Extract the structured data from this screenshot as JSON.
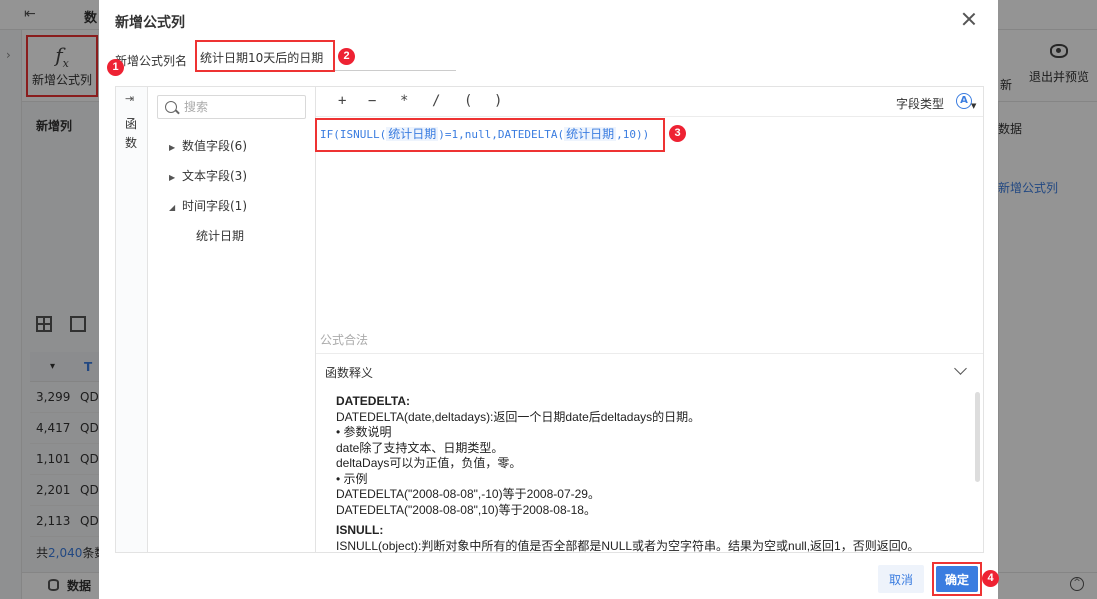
{
  "background": {
    "top_word": "数",
    "toolbar": {
      "add_formula_col": "新增公式列",
      "fx_symbol": "f",
      "fx_sub": "x",
      "right_word": "新",
      "exit_preview": "退出并预览"
    },
    "left_panel": {
      "new_col": "新增列"
    },
    "right_panel": {
      "data_word": "数据",
      "new_formula_col": "新增公式列"
    },
    "table": {
      "header_caret": "▾",
      "header_type": "T",
      "rows": [
        {
          "num": "3,299",
          "code": "QD"
        },
        {
          "num": "4,417",
          "code": "QD"
        },
        {
          "num": "1,101",
          "code": "QD"
        },
        {
          "num": "2,201",
          "code": "QD"
        },
        {
          "num": "2,113",
          "code": "QD"
        }
      ]
    },
    "total": {
      "prefix": "共",
      "count": "2,040",
      "suffix": "条数"
    },
    "bottom_bar": {
      "db_label": "数据"
    }
  },
  "dialog": {
    "title": "新增公式列",
    "name_label": "新增公式列名",
    "name_value": "统计日期10天后的日期",
    "fn_rail": {
      "label": "函数"
    },
    "search": {
      "placeholder": "搜索"
    },
    "tree": [
      {
        "label": "数值字段(6)",
        "expanded": false
      },
      {
        "label": "文本字段(3)",
        "expanded": false
      },
      {
        "label": "时间字段(1)",
        "expanded": true
      }
    ],
    "tree_leaf": "统计日期",
    "operators": [
      "+",
      "−",
      "*",
      "/",
      "(",
      ")"
    ],
    "field_type_label": "字段类型",
    "field_type_icon": "A",
    "formula": {
      "p1": "IF(ISNULL(",
      "f1": "统计日期",
      "p2": ")=1,null,DATEDELTA(",
      "f2": "统计日期",
      "p3": ",10))"
    },
    "valid_text": "公式合法",
    "explain": {
      "header": "函数释义",
      "lines": [
        "DATEDELTA(date,deltadays):返回一个日期date后deltadays的日期。",
        "• 参数说明",
        "date除了支持文本、日期类型。",
        "deltaDays可以为正值，负值，零。",
        "• 示例",
        "DATEDELTA(\"2008-08-08\",-10)等于2008-07-29。",
        "DATEDELTA(\"2008-08-08\",10)等于2008-08-18。"
      ],
      "fn1": "DATEDELTA:",
      "fn2": "ISNULL:",
      "fn2_desc": "ISNULL(object):判断对象中所有的值是否全部都是NULL或者为空字符串。结果为空或null,返回1，否则返回0。"
    },
    "buttons": {
      "cancel": "取消",
      "ok": "确定"
    },
    "annotations": [
      "1",
      "2",
      "3",
      "4"
    ],
    "colors": {
      "accent": "#3b7de0",
      "highlight": "#e33333"
    }
  }
}
